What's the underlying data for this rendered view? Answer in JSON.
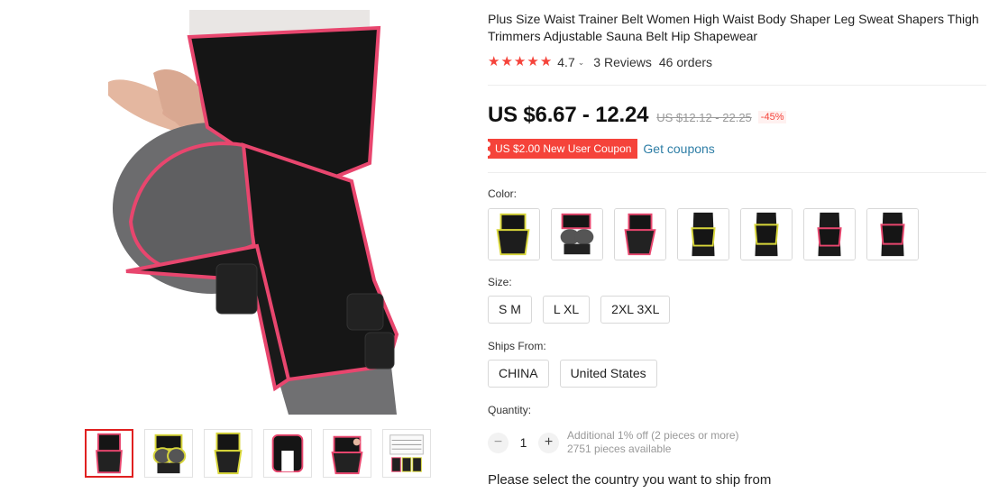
{
  "product": {
    "title": "Plus Size Waist Trainer Belt Women High Waist Body Shaper Leg Sweat Shapers Thigh Trimmers Adjustable Sauna Belt Hip Shapewear",
    "rating": "4.7",
    "rating_stars": 5,
    "reviews": "3 Reviews",
    "orders": "46 orders"
  },
  "price": {
    "current": "US $6.67 - 12.24",
    "original": "US $12.12 - 22.25",
    "discount": "-45%"
  },
  "coupon": {
    "badge": "US $2.00 New User Coupon",
    "link": "Get coupons"
  },
  "color": {
    "label": "Color:",
    "options": [
      "yellow-trim-front",
      "yellow-trim-back",
      "pink-trim-side",
      "yellow-trim-leg",
      "yellow-trim-leg-2",
      "pink-trim-leg",
      "pink-trim-leg-2"
    ]
  },
  "size": {
    "label": "Size:",
    "options": [
      "S M",
      "L XL",
      "2XL 3XL"
    ]
  },
  "ships_from": {
    "label": "Ships From:",
    "options": [
      "CHINA",
      "United States"
    ]
  },
  "quantity": {
    "label": "Quantity:",
    "value": "1",
    "minus": "−",
    "plus": "+",
    "note": "Additional 1% off (2 pieces or more)",
    "available": "2751 pieces available"
  },
  "shipping_message": "Please select the country you want to ship from",
  "colors": {
    "accent_red": "#f5433a",
    "link_blue": "#2e7ea6",
    "trim_pink": "#e8466e",
    "trim_yellow": "#d8d63a"
  }
}
